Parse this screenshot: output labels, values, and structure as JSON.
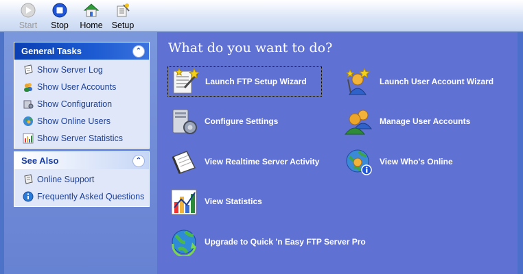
{
  "toolbar": {
    "buttons": [
      {
        "label": "Start",
        "icon": "play-icon",
        "enabled": false
      },
      {
        "label": "Stop",
        "icon": "stop-icon",
        "enabled": true
      },
      {
        "label": "Home",
        "icon": "home-icon",
        "enabled": true
      },
      {
        "label": "Setup",
        "icon": "setup-icon",
        "enabled": true
      }
    ]
  },
  "sidebar": {
    "general_tasks": {
      "title": "General Tasks",
      "items": [
        {
          "label": "Show Server Log",
          "icon": "log-icon"
        },
        {
          "label": "Show User Accounts",
          "icon": "users-icon"
        },
        {
          "label": "Show Configuration",
          "icon": "config-icon"
        },
        {
          "label": "Show Online Users",
          "icon": "online-icon"
        },
        {
          "label": "Show Server Statistics",
          "icon": "stats-icon"
        }
      ]
    },
    "see_also": {
      "title": "See Also",
      "items": [
        {
          "label": "Online Support",
          "icon": "support-icon"
        },
        {
          "label": "Frequently Asked Questions",
          "icon": "info-icon"
        }
      ]
    }
  },
  "main": {
    "title": "What do you want to do?",
    "actions": [
      {
        "label": "Launch FTP Setup Wizard",
        "icon": "wizard-icon"
      },
      {
        "label": "Launch User Account Wizard",
        "icon": "user-wizard-icon"
      },
      {
        "label": "Configure Settings",
        "icon": "settings-server-icon"
      },
      {
        "label": "Manage User Accounts",
        "icon": "manage-users-icon"
      },
      {
        "label": "View Realtime Server Activity",
        "icon": "notepad-icon"
      },
      {
        "label": "View Who's Online",
        "icon": "globe-info-icon"
      },
      {
        "label": "View Statistics",
        "icon": "chart-icon"
      },
      {
        "label": "Upgrade to Quick 'n Easy FTP Server Pro",
        "icon": "globe-arrow-icon"
      }
    ]
  }
}
